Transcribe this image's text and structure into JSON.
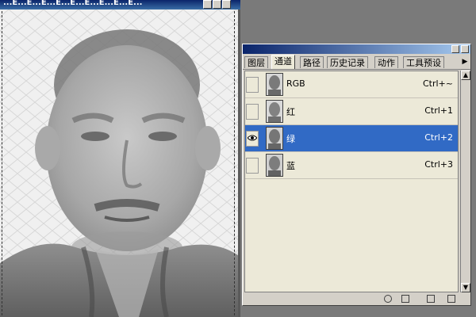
{
  "document": {
    "title": "...E...E...E...E...E...E...E...E...E..."
  },
  "panel": {
    "tabs": [
      {
        "label": "图层",
        "active": false
      },
      {
        "label": "通道",
        "active": true
      },
      {
        "label": "路径",
        "active": false
      },
      {
        "label": "历史记录",
        "active": false
      },
      {
        "label": "动作",
        "active": false
      },
      {
        "label": "工具预设",
        "active": false
      }
    ],
    "channels": [
      {
        "name": "RGB",
        "shortcut": "Ctrl+~",
        "visible": false,
        "selected": false
      },
      {
        "name": "红",
        "shortcut": "Ctrl+1",
        "visible": false,
        "selected": false
      },
      {
        "name": "绿",
        "shortcut": "Ctrl+2",
        "visible": true,
        "selected": true
      },
      {
        "name": "蓝",
        "shortcut": "Ctrl+3",
        "visible": false,
        "selected": false
      }
    ],
    "footer_icons": [
      "load-selection-icon",
      "save-selection-icon",
      "new-channel-icon",
      "delete-channel-icon"
    ]
  },
  "colors": {
    "selection": "#316ac5",
    "panel_bg": "#d4d0c8",
    "titlebar": "#0a246a"
  }
}
